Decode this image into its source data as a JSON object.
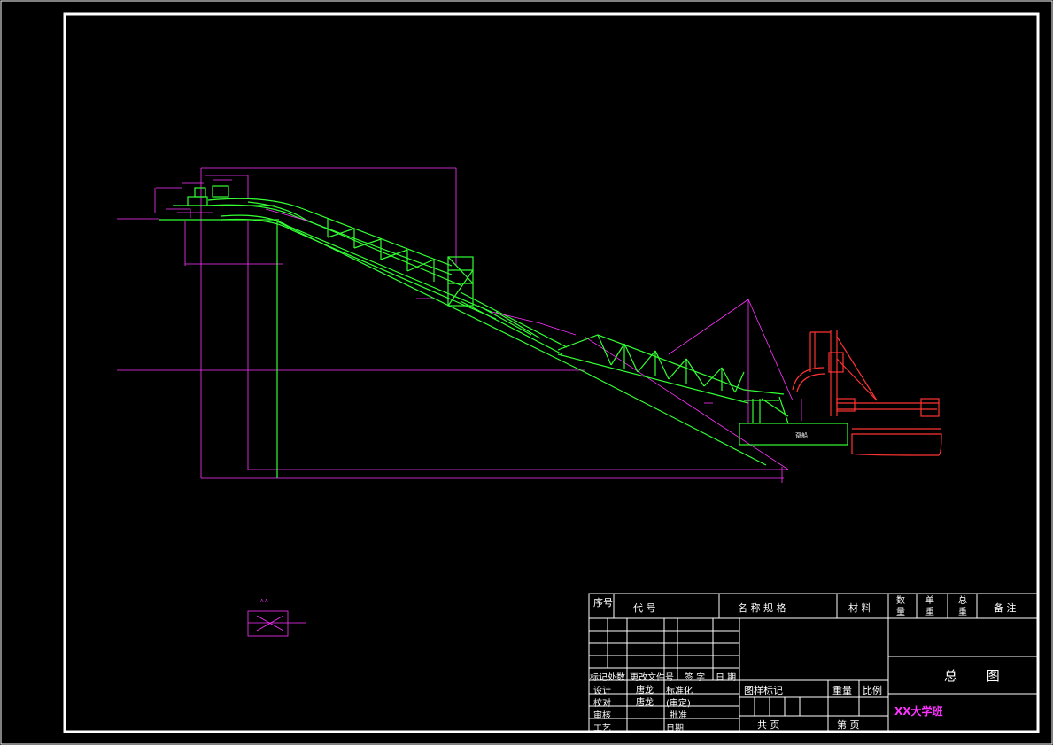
{
  "title_block": {
    "header": {
      "seq": "序号",
      "code": "代    号",
      "name_spec": "名 称 规 格",
      "material": "材 料",
      "qty": "数量",
      "unit_weight": "单重",
      "total_weight": "总重",
      "remark": "备 注"
    },
    "rev_labels": {
      "mark_count": "标记处数",
      "change_doc": "更改文件号",
      "sign": "签 字",
      "date": "日 期"
    },
    "roles": {
      "design": "设计",
      "check": "校对",
      "review": "审核",
      "process": "工艺"
    },
    "signatures": {
      "design_name": "唐龙",
      "check_name": "唐龙"
    },
    "approvals": {
      "standardize": "标准化",
      "approve_final": "(审定)",
      "approve": "批准",
      "date": "日期"
    },
    "drawing_mark": "图样标记",
    "weight": "重量",
    "scale": "比例",
    "drawing_title": "总 图",
    "school": "XX大学班",
    "total_sheets": "共   页",
    "sheet_no": "第   页"
  },
  "drawing_labels": {
    "boat": "趸船",
    "section": "A-A"
  },
  "colors": {
    "frame": "#ffffff",
    "structure": "#33ff33",
    "dimension": "#ff33ff",
    "crane": "#ff3333"
  }
}
